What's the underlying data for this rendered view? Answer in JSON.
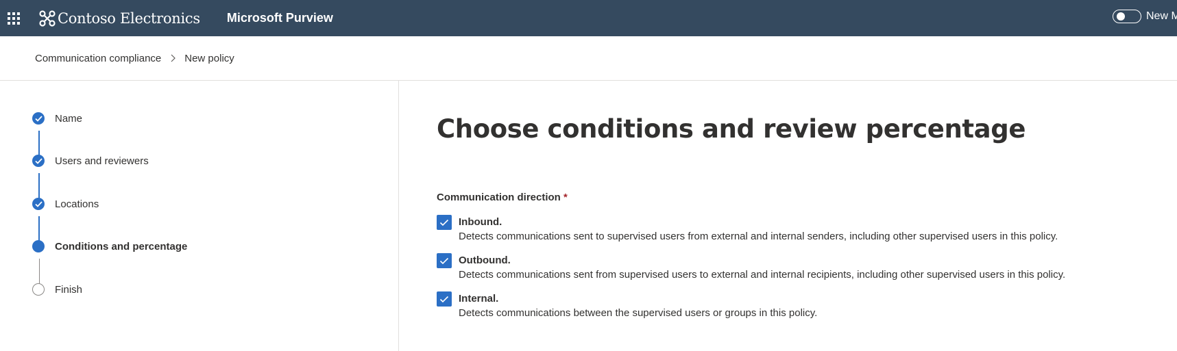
{
  "topbar": {
    "brand_name": "Contoso Electronics",
    "app_name": "Microsoft Purview",
    "toggle_label": "New M",
    "bg_color": "#354a5f"
  },
  "breadcrumb": {
    "items": [
      "Communication compliance",
      "New policy"
    ],
    "separator": ">"
  },
  "stepper": {
    "steps": [
      {
        "label": "Name",
        "state": "done"
      },
      {
        "label": "Users and reviewers",
        "state": "done"
      },
      {
        "label": "Locations",
        "state": "done"
      },
      {
        "label": "Conditions and percentage",
        "state": "current"
      },
      {
        "label": "Finish",
        "state": "pending"
      }
    ],
    "accent_color": "#2b6fc5"
  },
  "main": {
    "title": "Choose conditions and review percentage",
    "direction_label": "Communication direction",
    "required_mark": "*",
    "options": [
      {
        "title": "Inbound.",
        "description": "Detects communications sent to supervised users from external and internal senders, including other supervised users in this policy.",
        "checked": true
      },
      {
        "title": "Outbound.",
        "description": "Detects communications sent from supervised users to external and internal recipients, including other supervised users in this policy.",
        "checked": true
      },
      {
        "title": "Internal.",
        "description": "Detects communications between the supervised users or groups in this policy.",
        "checked": true
      }
    ]
  }
}
